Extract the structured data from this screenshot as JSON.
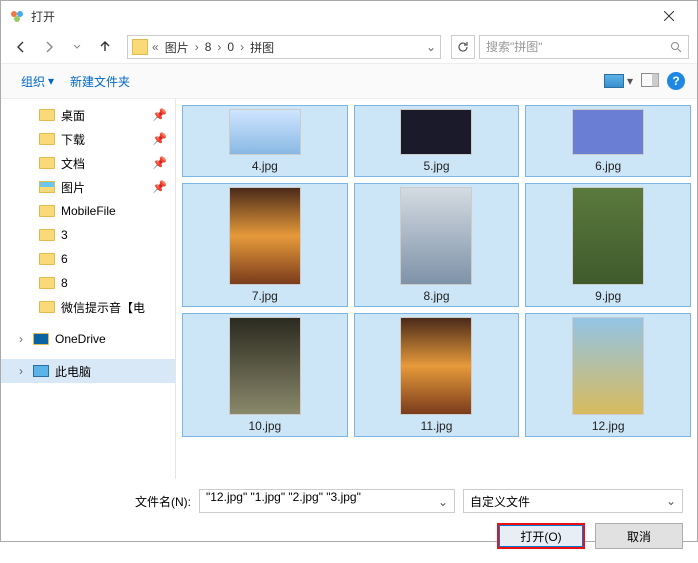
{
  "title": "打开",
  "breadcrumb": [
    "图片",
    "8",
    "0",
    "拼图"
  ],
  "search_placeholder": "搜索\"拼图\"",
  "toolbar": {
    "organize": "组织",
    "newfolder": "新建文件夹"
  },
  "tree": [
    {
      "label": "桌面",
      "pinned": true,
      "icon": "folder"
    },
    {
      "label": "下载",
      "pinned": true,
      "icon": "folder"
    },
    {
      "label": "文档",
      "pinned": true,
      "icon": "folder"
    },
    {
      "label": "图片",
      "pinned": true,
      "icon": "folder-img"
    },
    {
      "label": "MobileFile",
      "pinned": false,
      "icon": "folder"
    },
    {
      "label": "3",
      "pinned": false,
      "icon": "folder"
    },
    {
      "label": "6",
      "pinned": false,
      "icon": "folder"
    },
    {
      "label": "8",
      "pinned": false,
      "icon": "folder"
    },
    {
      "label": "微信提示音【电",
      "pinned": false,
      "icon": "folder"
    }
  ],
  "onedrive": "OneDrive",
  "thispc": "此电脑",
  "files": [
    {
      "name": "4.jpg",
      "sel": true,
      "cls": "sv-sky",
      "short": true
    },
    {
      "name": "5.jpg",
      "sel": true,
      "cls": "sv-shells",
      "short": true
    },
    {
      "name": "6.jpg",
      "sel": true,
      "cls": "sv-blue",
      "short": true
    },
    {
      "name": "7.jpg",
      "sel": true,
      "cls": "sv-sunset"
    },
    {
      "name": "8.jpg",
      "sel": true,
      "cls": "sv-sea"
    },
    {
      "name": "9.jpg",
      "sel": true,
      "cls": "sv-path"
    },
    {
      "name": "10.jpg",
      "sel": true,
      "cls": "sv-feather"
    },
    {
      "name": "11.jpg",
      "sel": true,
      "cls": "sv-sunset"
    },
    {
      "name": "12.jpg",
      "sel": true,
      "cls": "sv-wheat"
    }
  ],
  "filename_label": "文件名(N):",
  "filename_value": "\"12.jpg\" \"1.jpg\" \"2.jpg\" \"3.jpg\"",
  "filetype": "自定义文件",
  "open_btn": "打开(O)",
  "cancel_btn": "取消"
}
